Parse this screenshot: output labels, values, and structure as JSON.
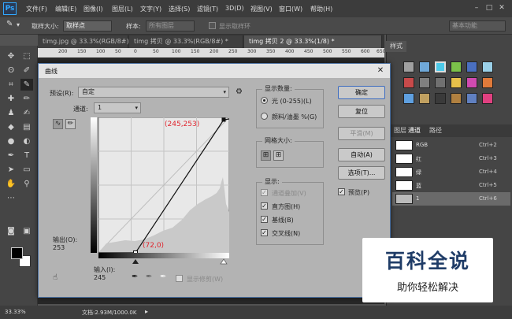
{
  "app": {
    "logo": "Ps"
  },
  "menu": [
    "文件(F)",
    "编辑(E)",
    "图像(I)",
    "图层(L)",
    "文字(Y)",
    "选择(S)",
    "滤镜(T)",
    "3D(D)",
    "视图(V)",
    "窗口(W)",
    "帮助(H)"
  ],
  "window_controls": {
    "minimize": "–",
    "maximize": "□",
    "close": "✕"
  },
  "options_bar": {
    "sample_size_label": "取样大小:",
    "sample_size_value": "取样点",
    "sample_label": "样本:",
    "sample_value": "所有图层",
    "show_ring_label": "显示取样环",
    "workspace": "基本功能"
  },
  "tabs": [
    "timg.jpg @ 33.3%(RGB/8#) *",
    "timg 拷贝 @ 33.3%(RGB/8#) *",
    "timg 拷贝 2 @ 33.3%(1/8) *"
  ],
  "ruler_numbers": [
    "200",
    "150",
    "100",
    "50",
    "0",
    "50",
    "100",
    "150",
    "200",
    "250",
    "300",
    "350",
    "400",
    "450",
    "500",
    "550",
    "600",
    "650"
  ],
  "status": {
    "zoom": "33.33%",
    "doc": "文档:2.93M/1000.0K"
  },
  "panel": {
    "styles_tab": "样式",
    "layer_tabs": [
      "图层",
      "通道",
      "路径"
    ],
    "channels": [
      {
        "name": "RGB",
        "shortcut": "Ctrl+2"
      },
      {
        "name": "红",
        "shortcut": "Ctrl+3"
      },
      {
        "name": "绿",
        "shortcut": "Ctrl+4"
      },
      {
        "name": "蓝",
        "shortcut": "Ctrl+5"
      },
      {
        "name": "1",
        "shortcut": "Ctrl+6"
      }
    ]
  },
  "dialog": {
    "title": "曲线",
    "preset_label": "预设(R):",
    "preset_value": "自定",
    "channel_label": "通道:",
    "channel_value": "1",
    "output_label": "输出(O):",
    "output_value": "253",
    "input_label": "输入(I):",
    "input_value": "245",
    "show_clipping": "显示修剪(W)",
    "annotation_top": "(245,253)",
    "annotation_bottom": "(72,0)",
    "buttons": {
      "ok": "确定",
      "reset": "复位",
      "smooth": "平滑(M)",
      "auto": "自动(A)",
      "options": "选项(T)..."
    },
    "preview_label": "预览(P)",
    "display_amount": {
      "title": "显示数量:",
      "light": "光 (0-255)(L)",
      "pigment": "颜料/油墨 %(G)"
    },
    "grid_size": {
      "title": "网格大小:"
    },
    "show": {
      "title": "显示:",
      "channel_overlays": "通道叠加(V)",
      "histogram": "直方图(H)",
      "baseline": "基线(B)",
      "intersection": "交叉线(N)"
    }
  },
  "watermark": {
    "title": "百科全说",
    "subtitle": "助你轻松解决"
  }
}
